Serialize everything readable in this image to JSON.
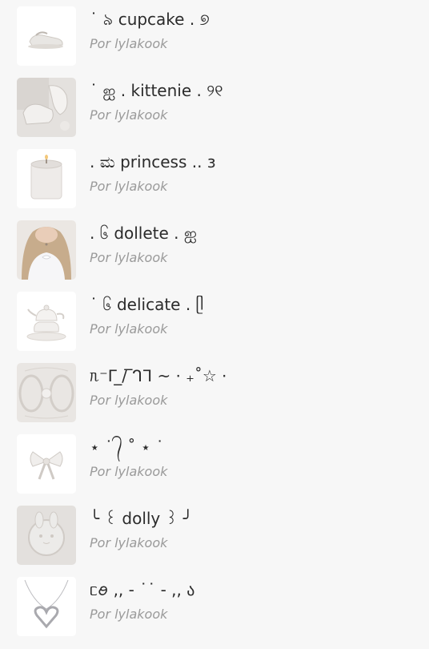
{
  "playlists": [
    {
      "title": "˙ ৯ cupcake . ୭",
      "author": "Por lylakook",
      "thumb": "shoes-image"
    },
    {
      "title": "˙ ஐ . kittenie . ୨୧",
      "author": "Por lylakook",
      "thumb": "white-shoes-collage-image"
    },
    {
      "title": ". ಮ princess .. ɜ",
      "author": "Por lylakook",
      "thumb": "candle-image"
    },
    {
      "title": ". ၆ dollete . ஐ",
      "author": "Por lylakook",
      "thumb": "girl-portrait-image"
    },
    {
      "title": "˙ ၆ delicate . ᥫ",
      "author": "Por lylakook",
      "thumb": "teapot-image"
    },
    {
      "title": "ᥰ⁻ᒥ ̲/ ̅ᒉᒣ ~ ⋅ ₊˚☆ ⋅",
      "author": "Por lylakook",
      "thumb": "lace-pattern-image"
    },
    {
      "title": "⋆ ˙ ᭄ ˚ ⋆ ˙",
      "author": "Por lylakook",
      "thumb": "white-bow-image"
    },
    {
      "title": "╰ ꒰ dolly ꒱ ╯",
      "author": "Por lylakook",
      "thumb": "embossed-bunny-image"
    },
    {
      "title": "ᥴꪮ ,, - ˙˙ - ,, ა",
      "author": "Por lylakook",
      "thumb": "heart-necklace-image"
    }
  ]
}
